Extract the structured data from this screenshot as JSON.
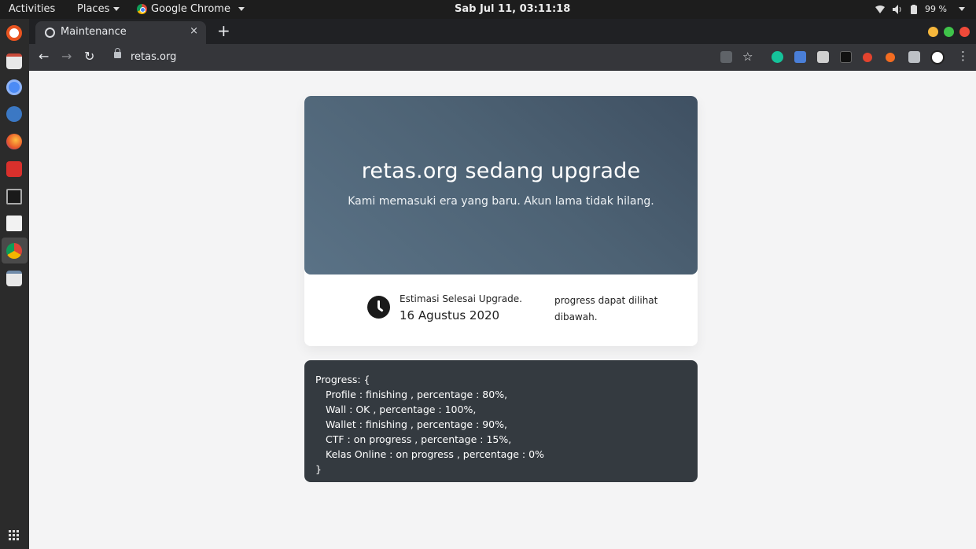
{
  "topbar": {
    "activities": "Activities",
    "places": "Places",
    "app": "Google Chrome",
    "clock": "Sab Jul 11, 03:11:18",
    "battery": "99 %"
  },
  "browser": {
    "tab_title": "Maintenance",
    "tab_close": "×",
    "new_tab": "+",
    "url": "retas.org"
  },
  "page": {
    "heading": "retas.org sedang upgrade",
    "subheading": "Kami memasuki era yang baru. Akun lama tidak hilang.",
    "estimate_label": "Estimasi Selesai Upgrade.",
    "estimate_date": "16 Agustus 2020",
    "note": "progress dapat dilihat dibawah.",
    "progress": {
      "open": "Progress: {",
      "lines": [
        "Profile : finishing , percentage : 80%,",
        "Wall : OK , percentage : 100%,",
        "Wallet : finishing , percentage : 90%,",
        "CTF : on progress , percentage : 15%,",
        "Kelas Online : on progress , percentage : 0%"
      ],
      "close": "}"
    }
  },
  "colors": {
    "hero_gradient_start": "#5a7286",
    "hero_gradient_end": "#3f5062",
    "progress_bg": "#343a40",
    "page_bg": "#f4f4f5"
  }
}
